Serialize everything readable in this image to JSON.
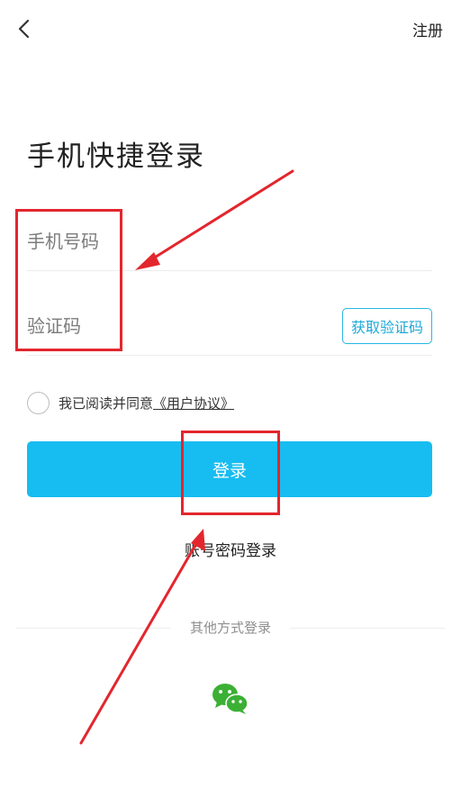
{
  "header": {
    "register_label": "注册"
  },
  "title": "手机快捷登录",
  "form": {
    "phone_placeholder": "手机号码",
    "code_placeholder": "验证码",
    "get_code_label": "获取验证码"
  },
  "agreement": {
    "text": "我已阅读并同意",
    "link_label": "《用户协议》",
    "checked": false
  },
  "login_button_label": "登录",
  "password_login_label": "账号密码登录",
  "other_methods_label": "其他方式登录",
  "colors": {
    "accent": "#17bdf0",
    "annotation": "#e3262d",
    "wechat": "#3cb034"
  }
}
